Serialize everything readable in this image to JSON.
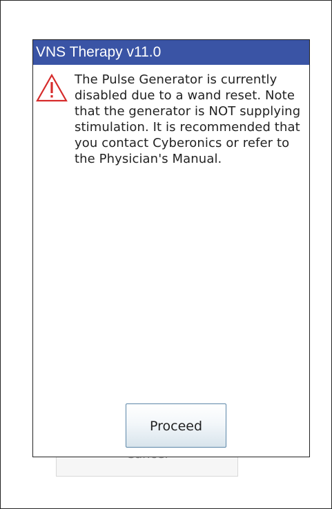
{
  "dialog": {
    "title": "VNS Therapy v11.0",
    "message": "The Pulse Generator is currently disabled due to a wand reset. Note that the generator is NOT supplying stimulation. It is recommended that you contact Cyberonics or refer to the Physician's Manual.",
    "icon": "warning-triangle-icon",
    "proceed_label": "Proceed"
  },
  "background": {
    "cancel_label": "Cancel"
  },
  "colors": {
    "titlebar": "#3a54a5",
    "warning": "#d62b2b",
    "button_border": "#5b86a8"
  }
}
